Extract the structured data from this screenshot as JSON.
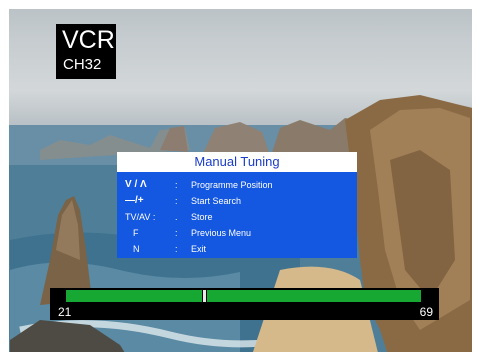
{
  "osd": {
    "source": "VCR",
    "channel": "CH32"
  },
  "menu": {
    "title": "Manual Tuning",
    "items": [
      {
        "key": "V / Λ",
        "sep": ":",
        "label": "Programme Position"
      },
      {
        "key": "—/+",
        "sep": ":",
        "label": "Start Search"
      },
      {
        "key": "TV/AV :",
        "sep": ".",
        "label": "Store"
      },
      {
        "key": "F",
        "sep": ":",
        "label": "Previous Menu"
      },
      {
        "key": "N",
        "sep": ":",
        "label": "Exit"
      }
    ]
  },
  "tuning_bar": {
    "min": "21",
    "max": "69",
    "level": 0.39
  },
  "colors": {
    "menu_bg": "#1457e0",
    "menu_title_text": "#1a3cc8",
    "bar_fill": "#16a832",
    "osd_bg": "#000000"
  }
}
